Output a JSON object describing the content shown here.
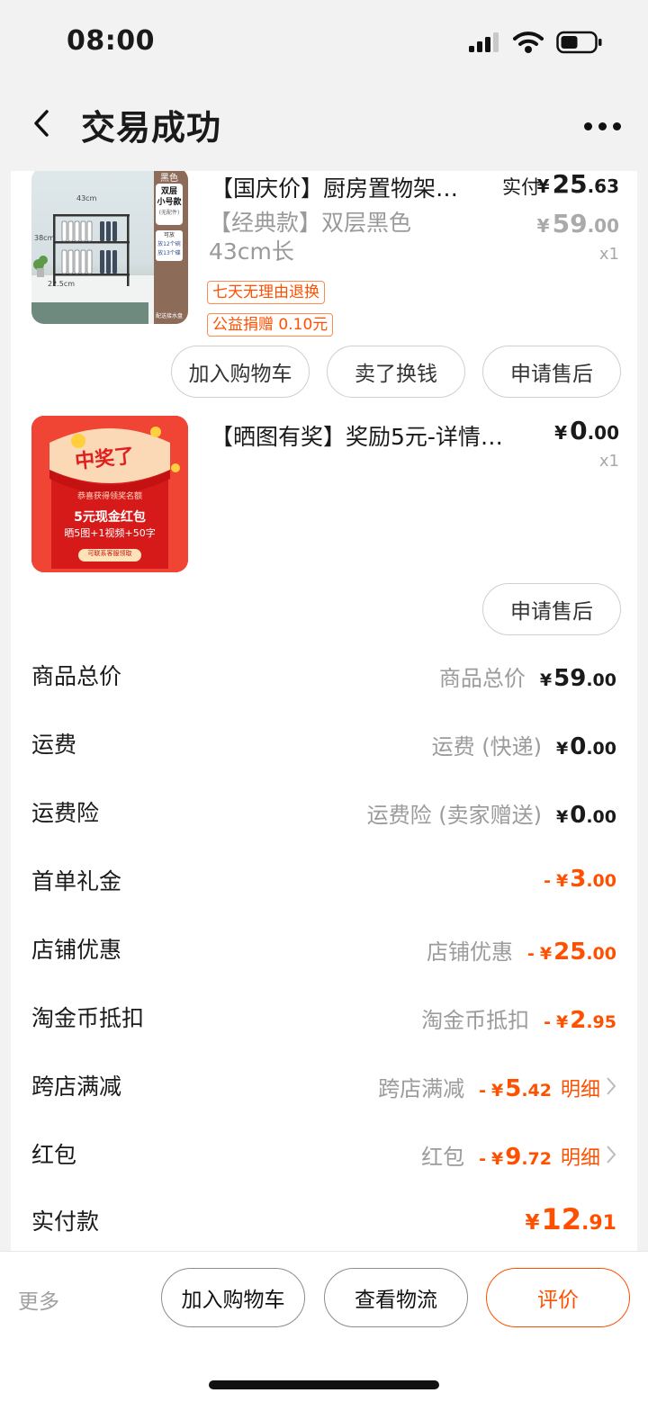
{
  "status": {
    "time": "08:00"
  },
  "nav": {
    "title": "交易成功"
  },
  "items": [
    {
      "title": "【国庆价】厨房置物架…",
      "pay_label": "实付",
      "pay_price": {
        "symbol": "¥",
        "int": "25",
        "dec": ".63"
      },
      "sku": "【经典款】双层黑色43cm长",
      "orig_price": {
        "symbol": "¥",
        "int": "59",
        "dec": ".00"
      },
      "qty": "x1",
      "tags": [
        "七天无理由退换",
        "公益捐赠 0.10元"
      ],
      "thumb": {
        "badge_color": "黑色",
        "badge_type": "双层\n小号款",
        "badge_note": "(无配件)",
        "dim_w": "43cm",
        "dim_h": "38cm",
        "dim_d": "22.5cm",
        "note_can": "可放",
        "note_a": "放12个碗",
        "note_b": "放13个碟",
        "note_c": "配送接水盘"
      },
      "buttons": [
        "加入购物车",
        "卖了换钱",
        "申请售后"
      ]
    },
    {
      "title": "【晒图有奖】奖励5元-详情…",
      "price": {
        "symbol": "¥",
        "int": "0",
        "dec": ".00"
      },
      "qty": "x1",
      "thumb": {
        "headline": "中奖了",
        "sub": "恭喜获得领奖名额",
        "main": "5元现金红包",
        "detail": "晒5图+1视频+50字",
        "cta": "可联系客服领取"
      },
      "buttons": [
        "申请售后"
      ]
    }
  ],
  "summary": [
    {
      "label": "商品总价",
      "desc": "商品总价",
      "prefix": "",
      "symbol": "¥",
      "int": "59",
      "dec": ".00"
    },
    {
      "label": "运费",
      "desc": "运费 (快递)",
      "prefix": "",
      "symbol": "¥",
      "int": "0",
      "dec": ".00"
    },
    {
      "label": "运费险",
      "desc": "运费险 (卖家赠送)",
      "prefix": "",
      "symbol": "¥",
      "int": "0",
      "dec": ".00"
    },
    {
      "label": "首单礼金",
      "desc": "",
      "prefix": "-",
      "symbol": "¥",
      "int": "3",
      "dec": ".00"
    },
    {
      "label": "店铺优惠",
      "desc": "店铺优惠",
      "prefix": "-",
      "symbol": "¥",
      "int": "25",
      "dec": ".00"
    },
    {
      "label": "淘金币抵扣",
      "desc": "淘金币抵扣",
      "prefix": "-",
      "symbol": "¥",
      "int": "2",
      "dec": ".95"
    },
    {
      "label": "跨店满减",
      "desc": "跨店满减",
      "prefix": "-",
      "symbol": "¥",
      "int": "5",
      "dec": ".42",
      "link": "明细"
    },
    {
      "label": "红包",
      "desc": "红包",
      "prefix": "-",
      "symbol": "¥",
      "int": "9",
      "dec": ".72",
      "link": "明细"
    }
  ],
  "total": {
    "label": "实付款",
    "symbol": "¥",
    "int": "12",
    "dec": ".91"
  },
  "bottom": {
    "more": "更多",
    "buttons": [
      "加入购物车",
      "查看物流",
      "评价"
    ]
  },
  "colors": {
    "accent": "#ff5000",
    "background": "#f2f2f2",
    "card": "#ffffff",
    "muted": "#9b9b9b"
  }
}
